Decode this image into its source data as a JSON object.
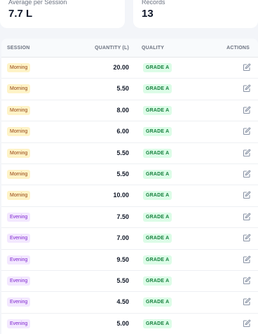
{
  "stats": {
    "avg_label": "Average per Session",
    "avg_value": "7.7 L",
    "records_label": "Records",
    "records_value": "13"
  },
  "table": {
    "headers": {
      "session": "SESSION",
      "quantity": "QUANTITY (L)",
      "quality": "QUALITY",
      "actions": "ACTIONS"
    },
    "rows": [
      {
        "session": "Morning",
        "quantity": "20.00",
        "quality": "GRADE A"
      },
      {
        "session": "Morning",
        "quantity": "5.50",
        "quality": "GRADE A"
      },
      {
        "session": "Morning",
        "quantity": "8.00",
        "quality": "GRADE A"
      },
      {
        "session": "Morning",
        "quantity": "6.00",
        "quality": "GRADE A"
      },
      {
        "session": "Morning",
        "quantity": "5.50",
        "quality": "GRADE A"
      },
      {
        "session": "Morning",
        "quantity": "5.50",
        "quality": "GRADE A"
      },
      {
        "session": "Morning",
        "quantity": "10.00",
        "quality": "GRADE A"
      },
      {
        "session": "Evening",
        "quantity": "7.50",
        "quality": "GRADE A"
      },
      {
        "session": "Evening",
        "quantity": "7.00",
        "quality": "GRADE A"
      },
      {
        "session": "Evening",
        "quantity": "9.50",
        "quality": "GRADE A"
      },
      {
        "session": "Evening",
        "quantity": "5.50",
        "quality": "GRADE A"
      },
      {
        "session": "Evening",
        "quantity": "4.50",
        "quality": "GRADE A"
      },
      {
        "session": "Evening",
        "quantity": "5.00",
        "quality": "GRADE A"
      }
    ],
    "action_icon": "edit-icon"
  },
  "colors": {
    "morning_badge_bg": "#fef3c7",
    "morning_badge_text": "#92400e",
    "evening_badge_bg": "#f3e8ff",
    "evening_badge_text": "#7e22ce",
    "grade_bg": "#dcfce7",
    "grade_text": "#15803d"
  }
}
